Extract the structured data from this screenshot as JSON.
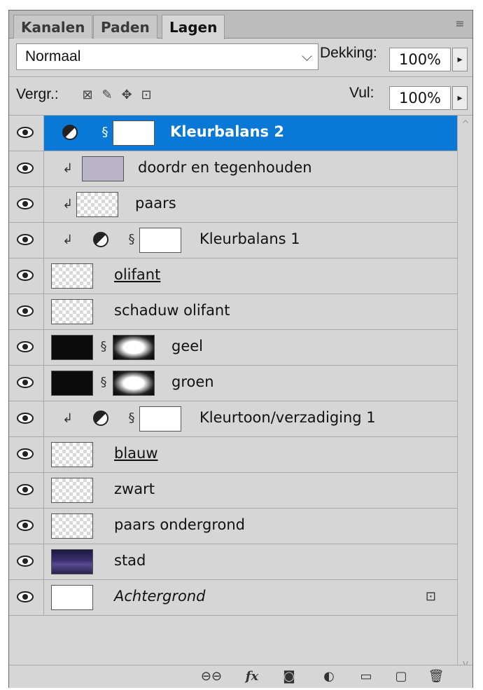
{
  "tabs": [
    {
      "label": "Kanalen"
    },
    {
      "label": "Paden"
    },
    {
      "label": "Lagen"
    }
  ],
  "blend": {
    "mode": "Normaal",
    "opacity_label": "Dekking:",
    "opacity_value": "100%"
  },
  "lock": {
    "label": "Vergr.:",
    "fill_label": "Vul:",
    "fill_value": "100%"
  },
  "layers": [
    {
      "name": "Kleurbalans 2",
      "type": "adjustment",
      "selected": true
    },
    {
      "name": "doordr en tegenhouden",
      "type": "pixel",
      "clipped": true
    },
    {
      "name": "paars",
      "type": "pixel",
      "clipped": true
    },
    {
      "name": "Kleurbalans 1",
      "type": "adjustment",
      "clipped": true
    },
    {
      "name": "olifant",
      "type": "smart"
    },
    {
      "name": "schaduw olifant",
      "type": "pixel"
    },
    {
      "name": "geel",
      "type": "masked"
    },
    {
      "name": "groen",
      "type": "masked"
    },
    {
      "name": "Kleurtoon/verzadiging 1",
      "type": "adjustment",
      "clipped": true
    },
    {
      "name": "blauw",
      "type": "smart"
    },
    {
      "name": "zwart",
      "type": "pixel"
    },
    {
      "name": "paars ondergrond",
      "type": "pixel"
    },
    {
      "name": "stad",
      "type": "pixel"
    },
    {
      "name": "Achtergrond",
      "type": "background",
      "locked": true
    }
  ],
  "colors": {
    "selection": "#0a78d7",
    "panel": "#d6d6d6"
  }
}
